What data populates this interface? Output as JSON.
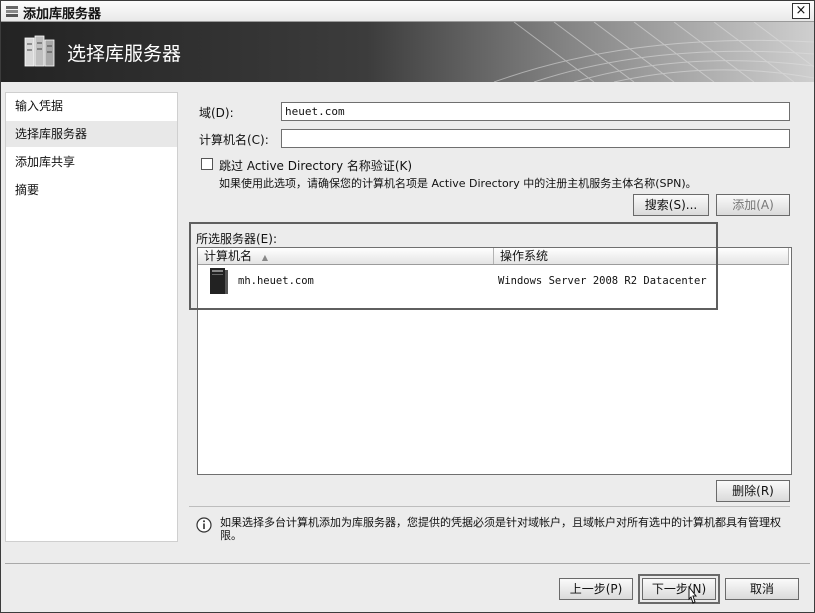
{
  "window": {
    "title": "添加库服务器",
    "close_glyph": "×"
  },
  "banner": {
    "title": "选择库服务器"
  },
  "nav": {
    "items": [
      {
        "label": "输入凭据"
      },
      {
        "label": "选择库服务器",
        "active": true
      },
      {
        "label": "添加库共享"
      },
      {
        "label": "摘要"
      }
    ]
  },
  "form": {
    "domain_label": "域(D):",
    "domain_value": "heuet.com",
    "computer_label": "计算机名(C):",
    "computer_value": "",
    "skip_ad_label": "跳过 Active Directory 名称验证(K)",
    "skip_ad_checked": false,
    "spn_note": "如果使用此选项，请确保您的计算机名项是 Active Directory 中的注册主机服务主体名称(SPN)。",
    "search_button": "搜索(S)...",
    "add_button": "添加(A)"
  },
  "selected_servers": {
    "label": "所选服务器(E):",
    "columns": [
      "计算机名",
      "操作系统"
    ],
    "sort_glyph": "▲",
    "rows": [
      {
        "computer": "mh.heuet.com",
        "os": "Windows Server 2008 R2 Datacenter"
      }
    ],
    "remove_button": "删除(R)"
  },
  "info": {
    "text": "如果选择多台计算机添加为库服务器，您提供的凭据必须是针对域帐户，且域帐户对所有选中的计算机都具有管理权限。"
  },
  "footer": {
    "prev_button": "上一步(P)",
    "next_button": "下一步(N)",
    "cancel_button": "取消"
  },
  "colors": {
    "banner_dark": "#232323",
    "banner_light": "#cfcfcf",
    "nav_active": "#e8e8e8",
    "highlight_frame": "#5f5f5f"
  }
}
